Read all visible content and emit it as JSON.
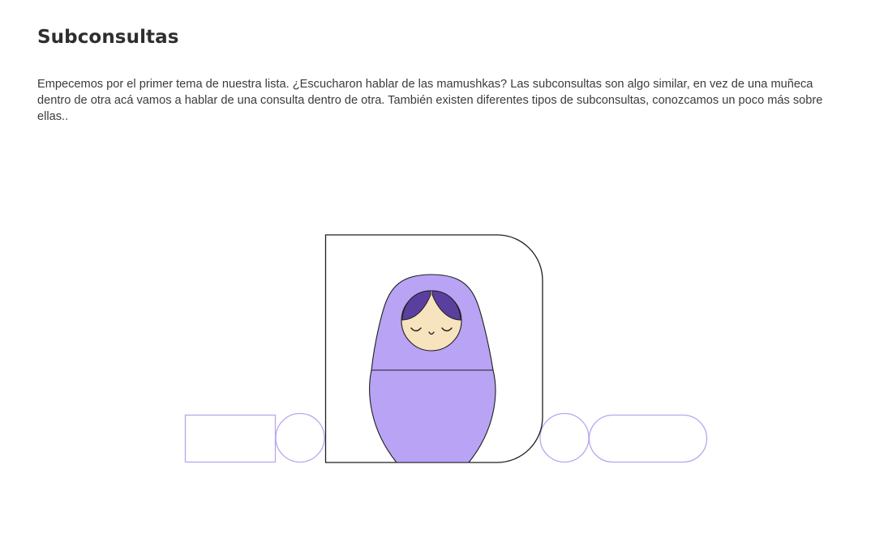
{
  "lesson": {
    "title": "Subconsultas",
    "intro": "Empecemos por el primer tema de nuestra lista. ¿Escucharon hablar de las mamushkas? Las subconsultas son algo similar, en vez de una muñeca dentro de otra acá vamos a hablar de una consulta dentro de otra. También existen diferentes tipos de subconsultas, conozcamos un poco más sobre ellas.."
  },
  "illustration": {
    "subject": "matryoshka-doll",
    "colors": {
      "outline_light": "#b9a6ee",
      "frame_outline": "#1f1f1f",
      "doll_body": "#b8a3f4",
      "doll_hair": "#5b3f9e",
      "doll_face": "#f8e3bf"
    }
  }
}
